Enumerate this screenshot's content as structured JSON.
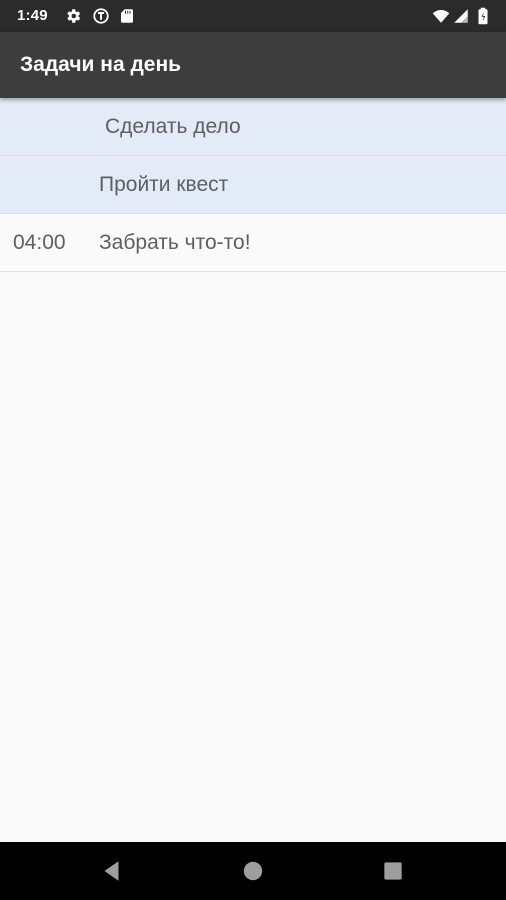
{
  "status_bar": {
    "time": "1:49",
    "icons": [
      "gear-icon",
      "sync-badge-icon",
      "sd-card-icon",
      "wifi-icon",
      "cell-signal-icon",
      "battery-icon"
    ]
  },
  "app_bar": {
    "title": "Задачи на день",
    "background": "#3d3d3d"
  },
  "tasks": [
    {
      "time": "",
      "title": "Сделать дело",
      "highlighted": true
    },
    {
      "time": "",
      "title": "Пройти квест",
      "highlighted": true
    },
    {
      "time": "04:00",
      "title": "Забрать что-то!",
      "highlighted": false
    }
  ],
  "colors": {
    "highlight": "#e3ebf8",
    "text": "#5f5f5f",
    "nav_icon": "#9e9e9e"
  },
  "nav_bar": {
    "buttons": [
      "back-icon",
      "home-icon",
      "recents-icon"
    ]
  }
}
